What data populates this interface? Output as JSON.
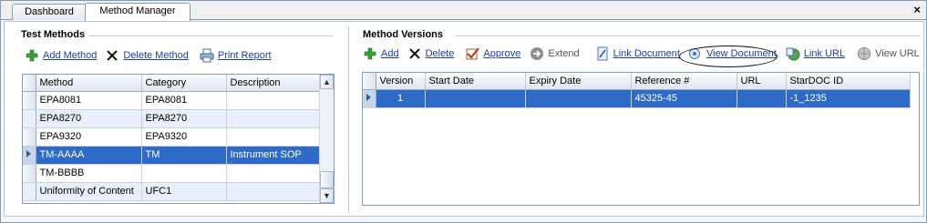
{
  "tabs": [
    {
      "label": "Dashboard"
    },
    {
      "label": "Method Manager"
    }
  ],
  "close_glyph": "×",
  "test_methods": {
    "title": "Test Methods",
    "toolbar": {
      "add": "Add Method",
      "delete": "Delete Method",
      "print": "Print Report"
    },
    "columns": [
      "Method",
      "Category",
      "Description"
    ],
    "rows": [
      {
        "method": "EPA8081",
        "category": "EPA8081",
        "description": ""
      },
      {
        "method": "EPA8270",
        "category": "EPA8270",
        "description": ""
      },
      {
        "method": "EPA9320",
        "category": "EPA9320",
        "description": ""
      },
      {
        "method": "TM-AAAA",
        "category": "TM",
        "description": "Instrument SOP"
      },
      {
        "method": "TM-BBBB",
        "category": "",
        "description": ""
      },
      {
        "method": "Uniformity of Content",
        "category": "UFC1",
        "description": ""
      }
    ],
    "selected_row": 3
  },
  "method_versions": {
    "title": "Method Versions",
    "toolbar": {
      "add": "Add",
      "delete": "Delete",
      "approve": "Approve",
      "extend": "Extend",
      "link_document": "Link Document",
      "view_document": "View Document",
      "link_url": "Link URL",
      "view_url": "View URL"
    },
    "columns": [
      "Version",
      "Start Date",
      "Expiry Date",
      "Reference #",
      "URL",
      "StarDOC ID"
    ],
    "rows": [
      {
        "version": "1",
        "start_date": "",
        "expiry_date": "",
        "reference": "45325-45",
        "url": "",
        "stardoc_id": "-1_1235"
      }
    ]
  },
  "icons": {
    "add": "plus-icon",
    "delete": "x-icon",
    "print": "printer-icon",
    "approve": "approve-check-icon",
    "extend": "extend-arrow-icon",
    "link_document": "link-document-icon",
    "view_document": "view-document-icon",
    "link_url": "link-url-icon",
    "view_url": "view-url-icon"
  },
  "colors": {
    "selection": "#2f6ac8",
    "alt_row": "#e8f0fb",
    "link": "#1a3ea8"
  }
}
